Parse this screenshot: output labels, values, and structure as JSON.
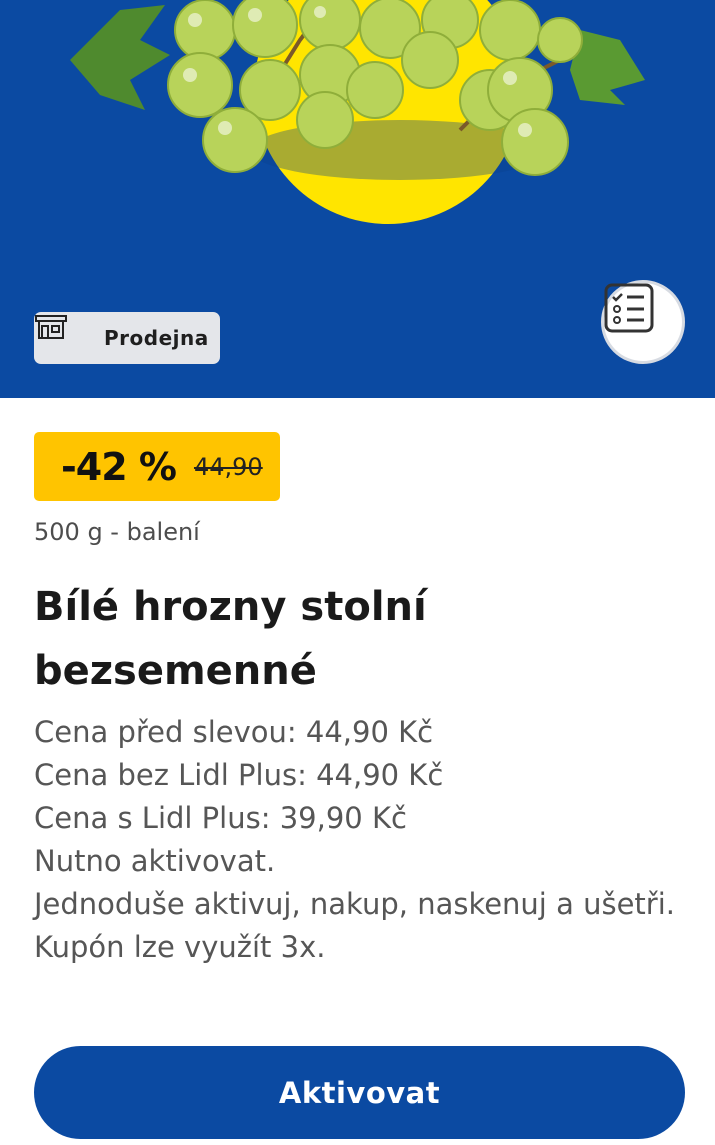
{
  "store_chip": {
    "label": "Prodejna",
    "icon": "store-icon"
  },
  "list_button": {
    "icon": "checklist-icon"
  },
  "price": {
    "discount": "-42 %",
    "old_price": "44,90"
  },
  "product": {
    "unit": "500 g - balení",
    "title_line1": "Bílé hrozny stolní",
    "title_line2": "bezsemenné"
  },
  "description": {
    "line1": "Cena před slevou: 44,90 Kč",
    "line2": "Cena bez Lidl Plus: 44,90 Kč",
    "line3": "Cena s Lidl Plus: 39,90 Kč",
    "line4": "Nutno aktivovat.",
    "line5": "Jednoduše aktivuj, nakup, naskenuj a ušetři.",
    "line6": "Kupón lze využít 3x."
  },
  "activate_button": {
    "label": "Aktivovat"
  },
  "colors": {
    "brand_blue": "#0b4aa2",
    "badge_yellow": "#ffc400",
    "chip_gray": "#e4e6ea"
  }
}
